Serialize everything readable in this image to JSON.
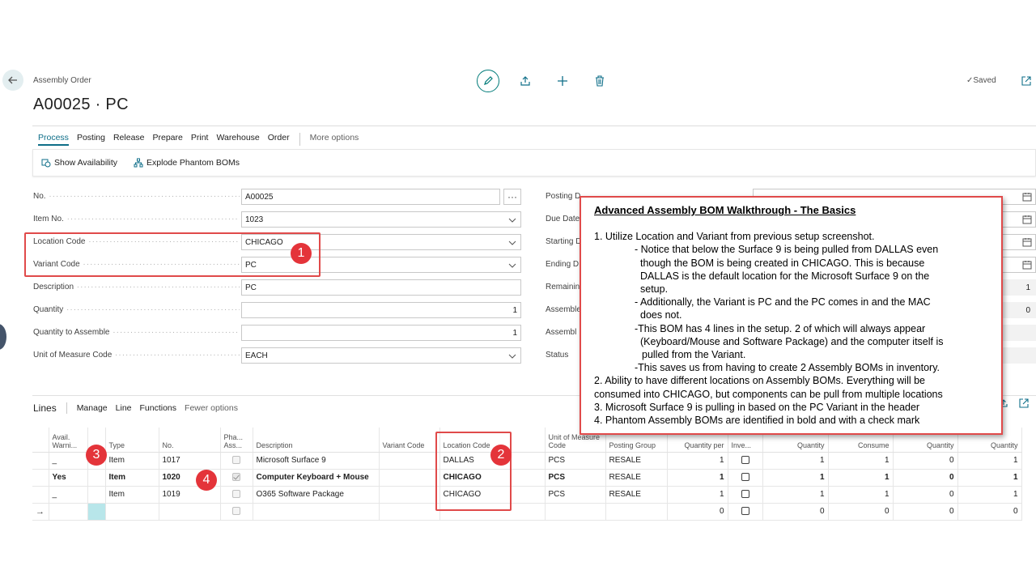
{
  "header": {
    "breadcrumb": "Assembly Order",
    "title": "A00025 · PC",
    "saved_label": "Saved"
  },
  "actions": {
    "items": [
      "Process",
      "Posting",
      "Release",
      "Prepare",
      "Print",
      "Warehouse",
      "Order"
    ],
    "more": "More options",
    "show_availability": "Show Availability",
    "explode_phantom": "Explode Phantom BOMs"
  },
  "form": {
    "no_label": "No.",
    "no_value": "A00025",
    "item_no_label": "Item No.",
    "item_no_value": "1023",
    "location_label": "Location Code",
    "location_value": "CHICAGO",
    "variant_label": "Variant Code",
    "variant_value": "PC",
    "description_label": "Description",
    "description_value": "PC",
    "quantity_label": "Quantity",
    "quantity_value": "1",
    "qty_assemble_label": "Quantity to Assemble",
    "qty_assemble_value": "1",
    "uom_label": "Unit of Measure Code",
    "uom_value": "EACH"
  },
  "form_right": {
    "posting_label": "Posting D",
    "due_label": "Due Date",
    "starting_label": "Starting D",
    "ending_label": "Ending D",
    "remaining_label": "Remainin",
    "assemble1_label": "Assemble",
    "assemble2_label": "Assembl",
    "status_label": "Status",
    "remaining_value": "1",
    "assemble1_value": "0"
  },
  "badges": [
    "1",
    "2",
    "3",
    "4"
  ],
  "lines": {
    "title": "Lines",
    "menu": [
      "Manage",
      "Line",
      "Functions"
    ],
    "fewer": "Fewer options",
    "headers": {
      "avail": "Avail. Warni...",
      "type": "Type",
      "no": "No.",
      "phantom": "Pha... Ass...",
      "description": "Description",
      "variant": "Variant Code",
      "location": "Location Code",
      "uom": "Unit of Measure Code",
      "posting_group": "Posting Group",
      "qty_per": "Quantity per",
      "inventory": "Inve...",
      "quantity": "Quantity",
      "consume": "Consume",
      "quantity2": "Quantity",
      "quantity3": "Quantity"
    },
    "rows": [
      {
        "avail": "_",
        "type": "Item",
        "no": "1017",
        "description": "Microsoft Surface 9",
        "location": "DALLAS",
        "uom": "PCS",
        "group": "RESALE",
        "qty_per": "1",
        "qty": "1",
        "consume": "1",
        "q2": "0",
        "q3": "1"
      },
      {
        "avail": "Yes",
        "type": "Item",
        "no": "1020",
        "description": "Computer Keyboard + Mouse",
        "location": "CHICAGO",
        "uom": "PCS",
        "group": "RESALE",
        "qty_per": "1",
        "qty": "1",
        "consume": "1",
        "q2": "0",
        "q3": "1"
      },
      {
        "avail": "_",
        "type": "Item",
        "no": "1019",
        "description": "O365 Software Package",
        "location": "CHICAGO",
        "uom": "PCS",
        "group": "RESALE",
        "qty_per": "1",
        "qty": "1",
        "consume": "1",
        "q2": "0",
        "q3": "1"
      },
      {
        "avail": "",
        "type": "",
        "no": "",
        "description": "",
        "location": "",
        "uom": "",
        "group": "",
        "qty_per": "0",
        "qty": "0",
        "consume": "0",
        "q2": "0",
        "q3": "0"
      }
    ]
  },
  "callout": {
    "title": "Advanced Assembly BOM Walkthrough - The Basics",
    "l1": "1. Utilize Location and Variant from previous setup screenshot.",
    "l2a": "- Notice that below the Surface 9 is being pulled from DALLAS even",
    "l2b": "though the BOM is being created in CHICAGO. This is because",
    "l2c": "DALLAS is the default location for the Microsoft Surface 9 on the",
    "l2d": "setup.",
    "l3a": "- Additionally, the Variant is PC and the PC comes in and the MAC",
    "l3b": "does not.",
    "l4a": "-This BOM has 4 lines in the setup. 2 of which will always appear",
    "l4b": "(Keyboard/Mouse and Software Package) and the computer itself is",
    "l4c": "pulled from the Variant.",
    "l5": "-This saves us from having to create 2 Assembly BOMs in inventory.",
    "l6a": "2. Ability to have different locations on Assembly BOMs. Everything will be",
    "l6b": "consumed into CHICAGO, but components can be pull from multiple locations",
    "l7": "3. Microsoft Surface 9 is pulling in based on the PC Variant in the header",
    "l8": "4. Phantom Assembly BOMs are identified in bold and with a check mark"
  },
  "colors": {
    "accent": "#0e6e88",
    "highlight_red": "#e04a4a",
    "badge_red": "#e4343a",
    "cyan_cell": "#b8e6ea"
  }
}
